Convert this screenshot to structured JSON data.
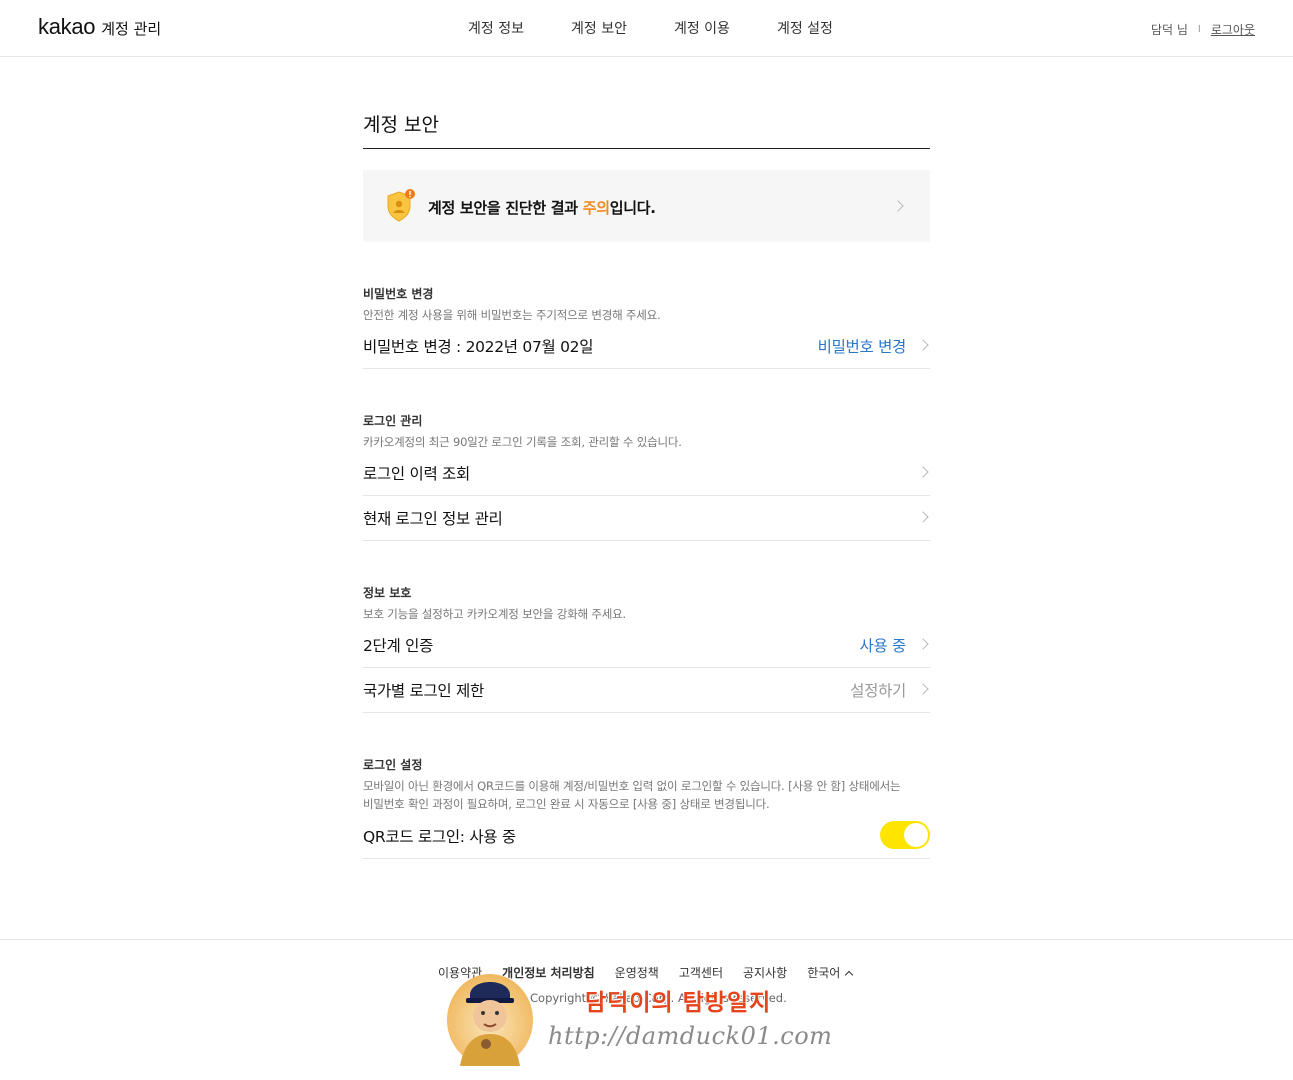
{
  "header": {
    "logo_word": "kakao",
    "logo_sub": "계정 관리",
    "nav": [
      "계정 정보",
      "계정 보안",
      "계정 이용",
      "계정 설정"
    ],
    "user_name": "담덕 님",
    "separator": "I",
    "logout": "로그아웃"
  },
  "page": {
    "title": "계정 보안",
    "diagnosis": {
      "prefix": "계정 보안을 진단한 결과 ",
      "status": "주의",
      "suffix": "입니다."
    }
  },
  "password": {
    "label": "비밀번호 변경",
    "desc": "안전한 계정 사용을 위해 비밀번호는 주기적으로 변경해 주세요.",
    "row_label": "비밀번호 변경 : 2022년 07월 02일",
    "row_action": "비밀번호 변경"
  },
  "login_mgmt": {
    "label": "로그인 관리",
    "desc": "카카오계정의 최근 90일간 로그인 기록을 조회, 관리할 수 있습니다.",
    "rows": [
      "로그인 이력 조회",
      "현재 로그인 정보 관리"
    ]
  },
  "protection": {
    "label": "정보 보호",
    "desc": "보호 기능을 설정하고 카카오계정 보안을 강화해 주세요.",
    "two_step_label": "2단계 인증",
    "two_step_value": "사용 중",
    "country_label": "국가별 로그인 제한",
    "country_value": "설정하기"
  },
  "login_settings": {
    "label": "로그인 설정",
    "desc_line1": "모바일이 아닌 환경에서 QR코드를 이용해 계정/비밀번호 입력 없이 로그인할 수 있습니다. [사용 안 함] 상태에서는",
    "desc_line2": "비밀번호 확인 과정이 필요하며, 로그인 완료 시 자동으로 [사용 중] 상태로 변경됩니다.",
    "qr_label": "QR코드 로그인: 사용 중",
    "qr_enabled": true
  },
  "footer": {
    "links": [
      "이용약관",
      "개인정보 처리방침",
      "운영정책",
      "고객센터",
      "공지사항"
    ],
    "language": "한국어",
    "copyright": "Copyright © Kakao Corp. All rights reserved."
  },
  "watermark": {
    "title": "담덕이의 탐방일지",
    "url": "http://damduck01.com"
  },
  "colors": {
    "warning": "#f28a1e",
    "link_blue": "#2a78c9",
    "toggle_on": "#fee500"
  }
}
